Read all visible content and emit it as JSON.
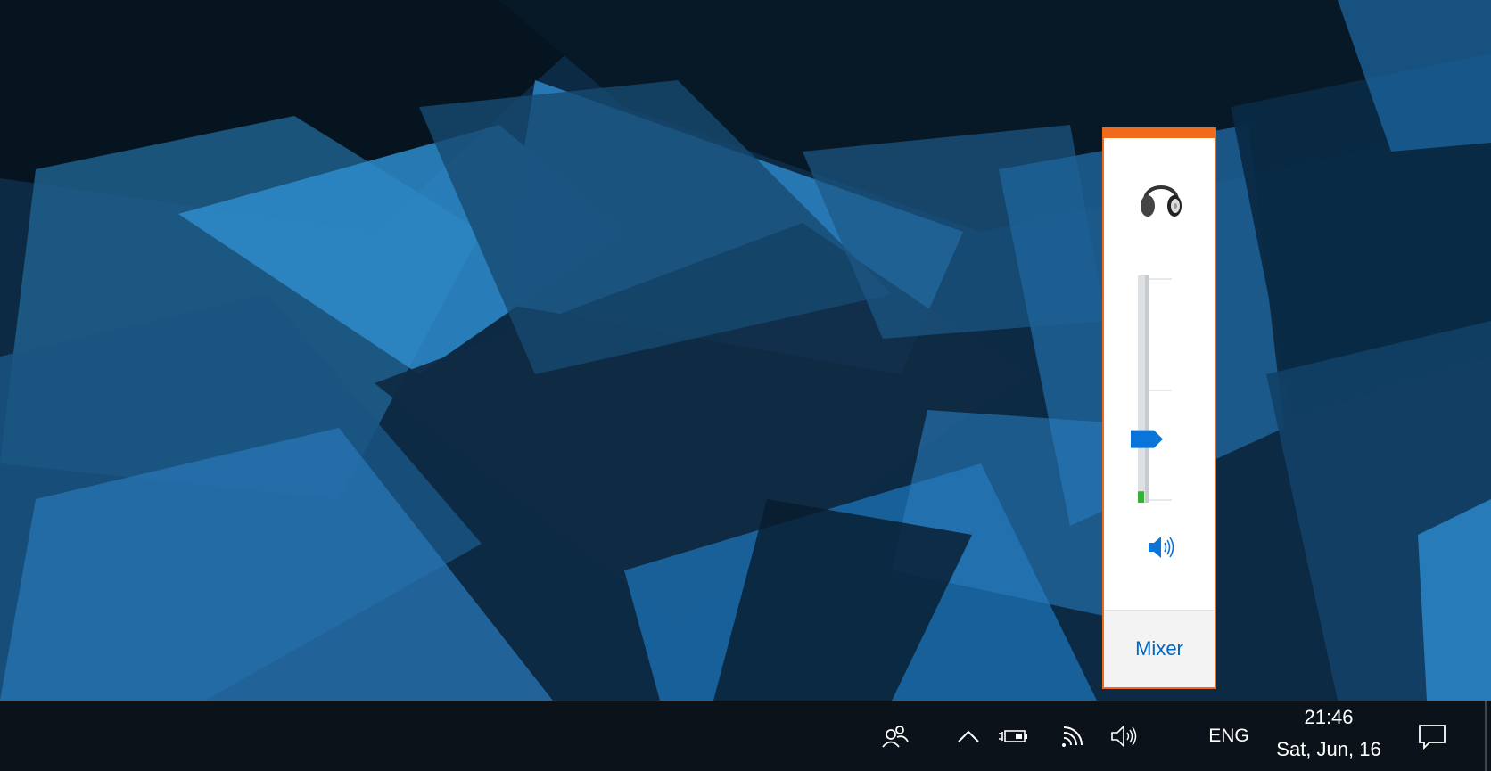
{
  "desktop": {
    "wallpaper": "abstract-blue-polygons"
  },
  "volume_flyout": {
    "accent_color": "#f06a1e",
    "device_icon": "headphones-icon",
    "volume_level_percent": 28,
    "meter_level_percent": 5,
    "mute_icon": "speaker-volume-icon",
    "mixer_label": "Mixer",
    "link_color": "#0067c0"
  },
  "taskbar": {
    "background": "#0b1219",
    "icons": [
      "people-icon",
      "chevron-up-icon",
      "battery-charging-icon",
      "wifi-icon",
      "speaker-icon",
      "action-center-icon"
    ],
    "language": "ENG",
    "clock": {
      "time": "21:46",
      "date": "Sat, Jun, 16"
    }
  }
}
